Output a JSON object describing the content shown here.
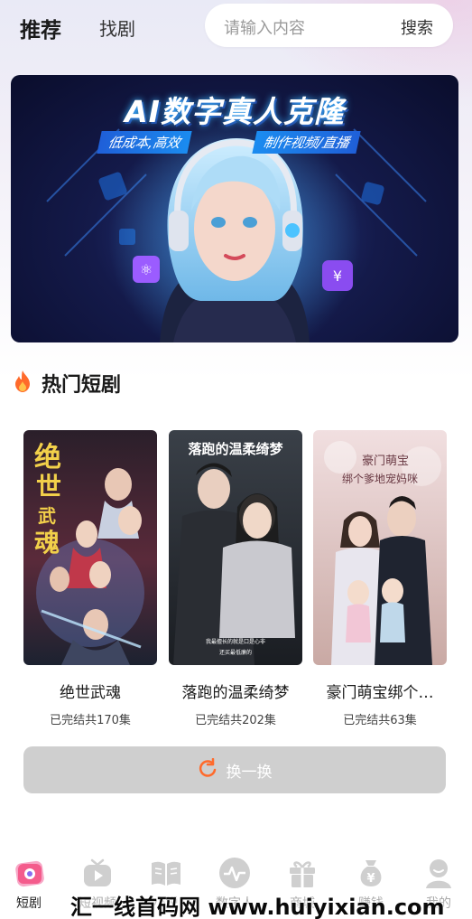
{
  "header": {
    "tab_recommend": "推荐",
    "tab_find": "找剧",
    "search_placeholder": "请输入内容",
    "search_button": "搜索"
  },
  "banner": {
    "title": "AI数字真人克隆",
    "subtitle_left": "低成本,高效",
    "subtitle_right": "制作视频/直播"
  },
  "section": {
    "icon": "fire-icon",
    "title": "热门短剧"
  },
  "dramas": [
    {
      "title": "绝世武魂",
      "status": "已完结共170集",
      "poster_text": "绝世武魂"
    },
    {
      "title": "落跑的温柔绮梦",
      "status": "已完结共202集",
      "poster_text": "落跑的温柔绮梦"
    },
    {
      "title": "豪门萌宝绑个…",
      "status": "已完结共63集",
      "poster_text": "豪门萌宝 绑个爹地宠妈咪"
    }
  ],
  "refresh": {
    "label": "换一换",
    "icon": "refresh-icon"
  },
  "tabbar": {
    "items": [
      {
        "label": "短剧",
        "icon": "short-drama-icon",
        "active": true
      },
      {
        "label": "短视频",
        "icon": "play-icon",
        "active": false
      },
      {
        "label": "小说",
        "icon": "book-icon",
        "active": false
      },
      {
        "label": "数字人",
        "icon": "pulse-icon",
        "active": false
      },
      {
        "label": "商城",
        "icon": "gift-icon",
        "active": false
      },
      {
        "label": "赚钱",
        "icon": "money-bag-icon",
        "active": false
      },
      {
        "label": "我的",
        "icon": "user-icon",
        "active": false
      }
    ]
  },
  "watermark": "汇一线首码网 www.huiyixian.com",
  "colors": {
    "accent": "#ff6a2b",
    "banner_bg": "#141a4a",
    "refresh_bg": "#cfcfcf"
  }
}
